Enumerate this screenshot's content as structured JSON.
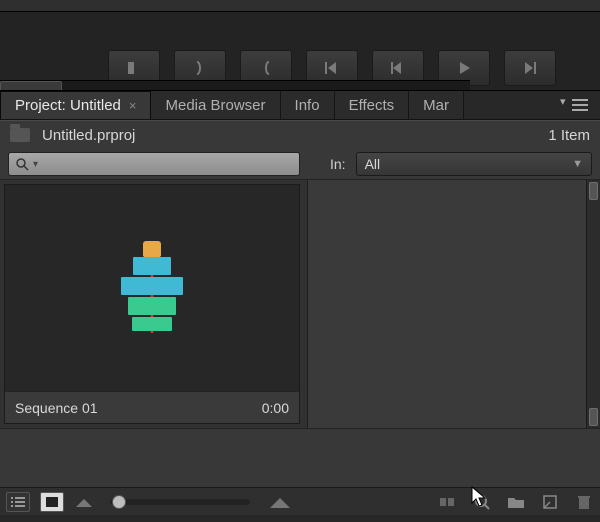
{
  "tabs": {
    "project": "Project: Untitled",
    "media_browser": "Media Browser",
    "info": "Info",
    "effects": "Effects",
    "markers": "Mar"
  },
  "project": {
    "filename": "Untitled.prproj",
    "item_count": "1 Item"
  },
  "search": {
    "placeholder": ""
  },
  "filter": {
    "in_label": "In:",
    "value": "All"
  },
  "clip": {
    "name": "Sequence 01",
    "duration": "0:00"
  }
}
